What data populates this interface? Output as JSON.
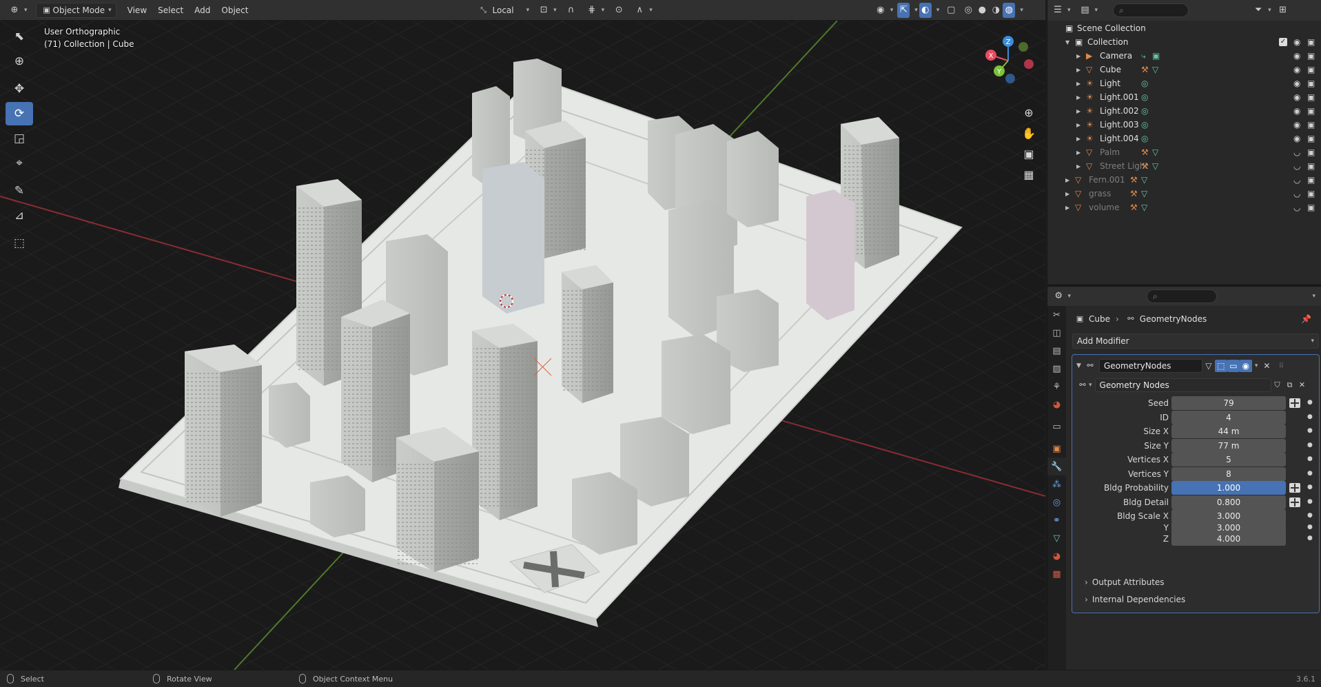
{
  "header": {
    "mode_label": "Object Mode",
    "menus": [
      "View",
      "Select",
      "Add",
      "Object"
    ],
    "orientation_label": "Local"
  },
  "viewport": {
    "view_name": "User Orthographic",
    "collection_info": "(71) Collection | Cube",
    "gizmo_axes": {
      "x": "X",
      "y": "Y",
      "z": "Z"
    }
  },
  "toolbar": {
    "tools": [
      "select-box-tool",
      "cursor-tool",
      "move-tool",
      "rotate-tool",
      "scale-tool",
      "transform-tool",
      "annotate-tool",
      "measure-tool",
      "add-cube-tool"
    ],
    "active_tool": "rotate-tool"
  },
  "outliner": {
    "search_placeholder": "",
    "scene_collection": "Scene Collection",
    "collection": "Collection",
    "items": [
      {
        "name": "Camera",
        "type": "camera",
        "dim": false
      },
      {
        "name": "Cube",
        "type": "mesh",
        "dim": false
      },
      {
        "name": "Light",
        "type": "light",
        "dim": false
      },
      {
        "name": "Light.001",
        "type": "light",
        "dim": false
      },
      {
        "name": "Light.002",
        "type": "light",
        "dim": false
      },
      {
        "name": "Light.003",
        "type": "light",
        "dim": false
      },
      {
        "name": "Light.004",
        "type": "light",
        "dim": false
      },
      {
        "name": "Palm",
        "type": "mesh",
        "dim": true
      },
      {
        "name": "Street Light",
        "type": "mesh",
        "dim": true
      },
      {
        "name": "Fern.001",
        "type": "mesh",
        "dim": true
      },
      {
        "name": "grass",
        "type": "mesh",
        "dim": true
      },
      {
        "name": "volume",
        "type": "mesh",
        "dim": true
      }
    ]
  },
  "properties": {
    "breadcrumb_object": "Cube",
    "breadcrumb_modifier": "GeometryNodes",
    "add_modifier_label": "Add Modifier",
    "modifier_name": "GeometryNodes",
    "node_group": "Geometry Nodes",
    "params": [
      {
        "label": "Seed",
        "value": "79",
        "attr": true
      },
      {
        "label": "ID",
        "value": "4",
        "attr": false
      },
      {
        "label": "Size X",
        "value": "44 m",
        "attr": false
      },
      {
        "label": "Size Y",
        "value": "77 m",
        "attr": false
      },
      {
        "label": "Vertices X",
        "value": "5",
        "attr": false
      },
      {
        "label": "Vertices Y",
        "value": "8",
        "attr": false
      },
      {
        "label": "Bldg Probability",
        "value": "1.000",
        "attr": true
      },
      {
        "label": "Bldg Detail",
        "value": "0.800",
        "attr": true
      },
      {
        "label": "Bldg Scale X",
        "value": "3.000",
        "attr": false
      },
      {
        "label": "Y",
        "value": "3.000",
        "attr": false
      },
      {
        "label": "Z",
        "value": "4.000",
        "attr": false
      }
    ],
    "output_attributes_label": "Output Attributes",
    "internal_dependencies_label": "Internal Dependencies"
  },
  "statusbar": {
    "left_action": "Select",
    "middle_action": "Rotate View",
    "right_action": "Object Context Menu",
    "version": "3.6.1"
  },
  "colors": {
    "accent": "#4772b3",
    "axis_x": "#e64d5e",
    "axis_y": "#7dc23a",
    "axis_z": "#3d8cd8",
    "object_icon": "#e0894b",
    "data_icon": "#63c7a9"
  }
}
